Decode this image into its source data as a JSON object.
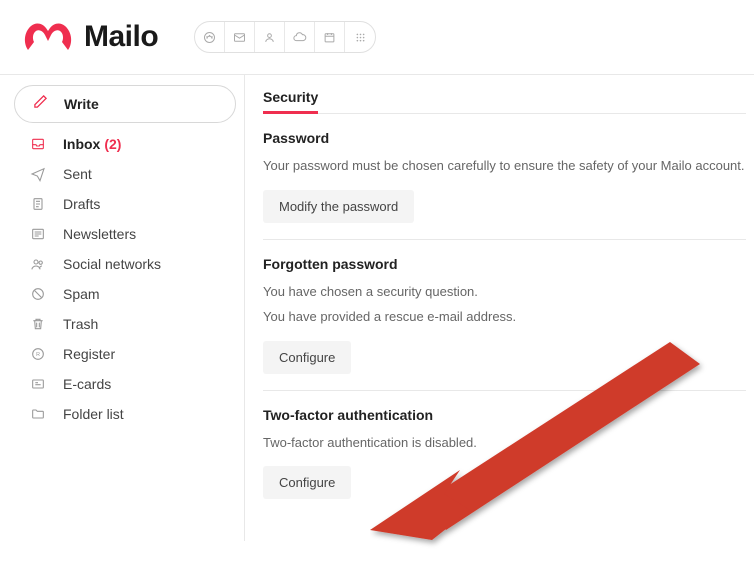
{
  "brand": "Mailo",
  "toolbar": {
    "items": [
      "dashboard-icon",
      "mail-icon",
      "contacts-icon",
      "cloud-icon",
      "calendar-icon",
      "apps-icon"
    ]
  },
  "compose": {
    "label": "Write"
  },
  "folders": [
    {
      "key": "inbox",
      "label": "Inbox",
      "count": "(2)",
      "icon": "inbox-icon",
      "active": true
    },
    {
      "key": "sent",
      "label": "Sent",
      "icon": "sent-icon"
    },
    {
      "key": "drafts",
      "label": "Drafts",
      "icon": "drafts-icon"
    },
    {
      "key": "newsletters",
      "label": "Newsletters",
      "icon": "newsletters-icon"
    },
    {
      "key": "social",
      "label": "Social networks",
      "icon": "social-icon"
    },
    {
      "key": "spam",
      "label": "Spam",
      "icon": "spam-icon"
    },
    {
      "key": "trash",
      "label": "Trash",
      "icon": "trash-icon"
    },
    {
      "key": "register",
      "label": "Register",
      "icon": "register-icon"
    },
    {
      "key": "ecards",
      "label": "E-cards",
      "icon": "ecards-icon"
    },
    {
      "key": "folderlist",
      "label": "Folder list",
      "icon": "folder-icon"
    }
  ],
  "main": {
    "tab": "Security",
    "sections": {
      "password": {
        "title": "Password",
        "desc": "Your password must be chosen carefully to ensure the safety of your Mailo account.",
        "button": "Modify the password"
      },
      "forgotten": {
        "title": "Forgotten password",
        "line1": "You have chosen a security question.",
        "line2": "You have provided a rescue e-mail address.",
        "button": "Configure"
      },
      "twofa": {
        "title": "Two-factor authentication",
        "desc": "Two-factor authentication is disabled.",
        "button": "Configure"
      }
    }
  },
  "colors": {
    "accent": "#ef2e4f"
  }
}
